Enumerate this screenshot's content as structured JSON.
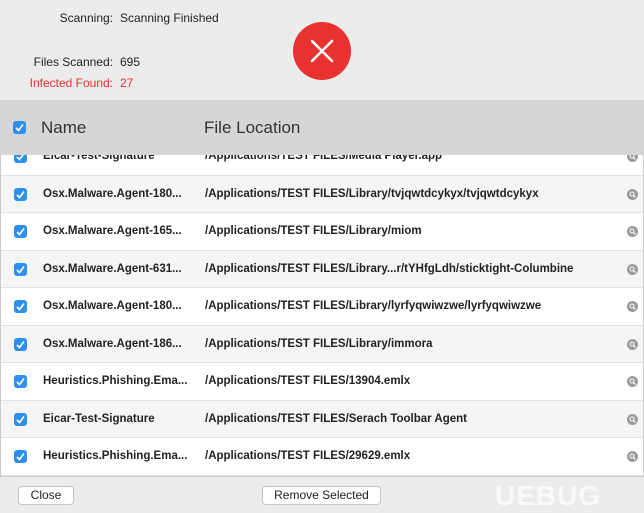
{
  "status": {
    "scanning_label": "Scanning:",
    "scanning_value": "Scanning Finished",
    "files_label": "Files Scanned:",
    "files_value": "695",
    "infected_label": "Infected Found:",
    "infected_value": "27",
    "error_icon": "x-circle-icon",
    "accent": "#e8322f"
  },
  "table": {
    "columns": [
      "Name",
      "File Location"
    ],
    "rows": [
      {
        "name": "Eicar-Test-Signature",
        "location": "/Applications/TEST FILES/Media Player.app",
        "checked": true
      },
      {
        "name": "Osx.Malware.Agent-180...",
        "location": "/Applications/TEST FILES/Library/tvjqwtdcykyx/tvjqwtdcykyx",
        "checked": true
      },
      {
        "name": "Osx.Malware.Agent-165...",
        "location": "/Applications/TEST FILES/Library/miom",
        "checked": true
      },
      {
        "name": "Osx.Malware.Agent-631...",
        "location": "/Applications/TEST FILES/Library...r/tYHfgLdh/sticktight-Columbine",
        "checked": true
      },
      {
        "name": "Osx.Malware.Agent-180...",
        "location": "/Applications/TEST FILES/Library/lyrfyqwiwzwe/lyrfyqwiwzwe",
        "checked": true
      },
      {
        "name": "Osx.Malware.Agent-186...",
        "location": "/Applications/TEST FILES/Library/immora",
        "checked": true
      },
      {
        "name": "Heuristics.Phishing.Ema...",
        "location": "/Applications/TEST FILES/13904.emlx",
        "checked": true
      },
      {
        "name": "Eicar-Test-Signature",
        "location": "/Applications/TEST FILES/Serach Toolbar Agent",
        "checked": true
      },
      {
        "name": "Heuristics.Phishing.Ema...",
        "location": "/Applications/TEST FILES/29629.emlx",
        "checked": true
      }
    ]
  },
  "buttons": {
    "close": "Close",
    "remove": "Remove Selected"
  },
  "watermark": "UEBUG"
}
